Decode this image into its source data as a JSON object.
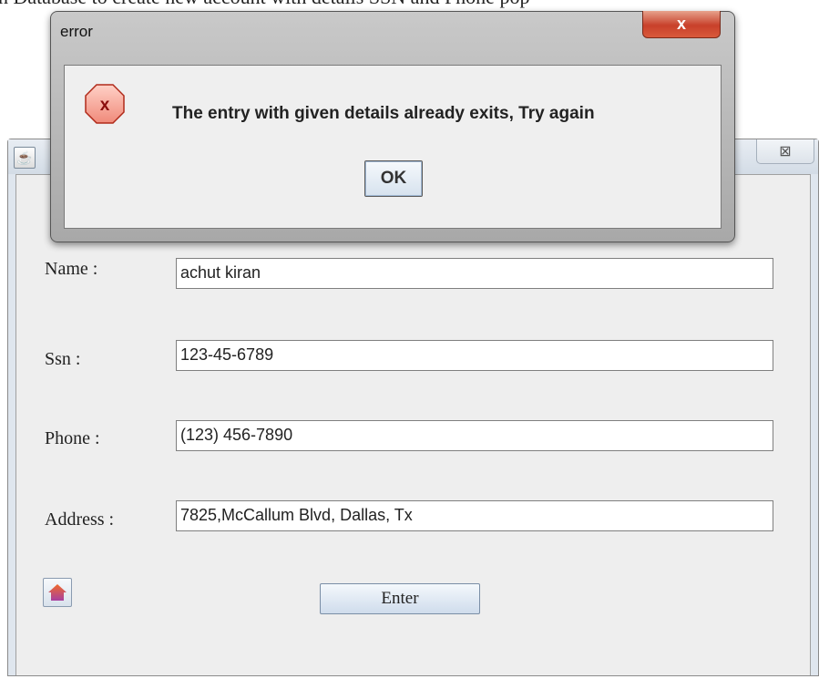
{
  "background": {
    "text": "n Database to create new account with details SSN and Phone pop"
  },
  "main_window": {
    "icon": "java-app-icon",
    "close_glyph": "⊠",
    "fields": [
      {
        "label": "Name :",
        "value": "achut kiran"
      },
      {
        "label": "Ssn :",
        "value": "123-45-6789"
      },
      {
        "label": "Phone :",
        "value": "(123) 456-7890"
      },
      {
        "label": "Address :",
        "value": "7825,McCallum Blvd, Dallas, Tx"
      }
    ],
    "home_icon": "home-icon",
    "enter_label": "Enter"
  },
  "dialog": {
    "title": "error",
    "close_glyph": "x",
    "icon": "error-icon",
    "message": "The entry with given details already exits, Try again",
    "ok_label": "OK"
  },
  "colors": {
    "error_red": "#c8402a",
    "button_blue": "#cfdcec",
    "panel_gray": "#eeeeee"
  }
}
